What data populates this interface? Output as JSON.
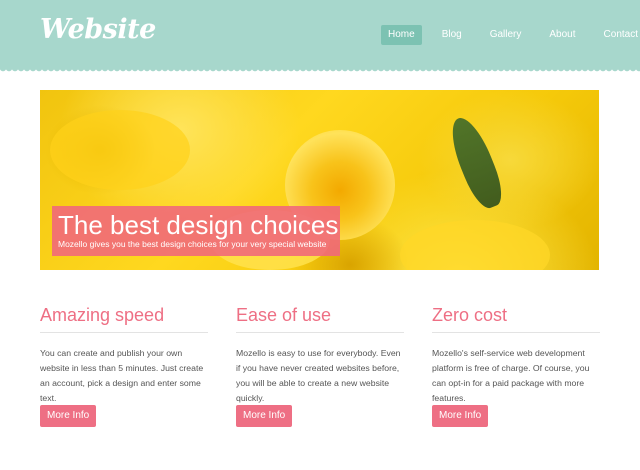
{
  "brand": {
    "logo_text": "Website"
  },
  "nav": {
    "items": [
      {
        "label": "Home",
        "active": true
      },
      {
        "label": "Blog",
        "active": false
      },
      {
        "label": "Gallery",
        "active": false
      },
      {
        "label": "About",
        "active": false
      },
      {
        "label": "Contact",
        "active": false
      }
    ]
  },
  "hero": {
    "title": "The best design choices",
    "subtitle": "Mozello gives you the best design choices for your very special website",
    "image_subject": "yellow daffodils"
  },
  "features": [
    {
      "title": "Amazing speed",
      "lines": [
        "You can create and publish your own",
        "website in less than 5 minutes. Just create",
        "an account, pick a design and enter some",
        "text."
      ],
      "button": "More Info"
    },
    {
      "title": "Ease of use",
      "lines": [
        "Mozello is easy to use for everybody. Even",
        "if you have never created websites before,",
        "you will be able to create a new website",
        "quickly."
      ],
      "button": "More Info"
    },
    {
      "title": "Zero cost",
      "lines": [
        "Mozello's self-service web development",
        "platform is free of charge. Of course, you",
        "can opt-in for a paid package with more",
        "features."
      ],
      "button": "More Info"
    }
  ],
  "colors": {
    "header_bg": "#a7d7cc",
    "nav_active_bg": "#7cc2b2",
    "accent_pink": "#ee6f84",
    "text": "#555555"
  }
}
